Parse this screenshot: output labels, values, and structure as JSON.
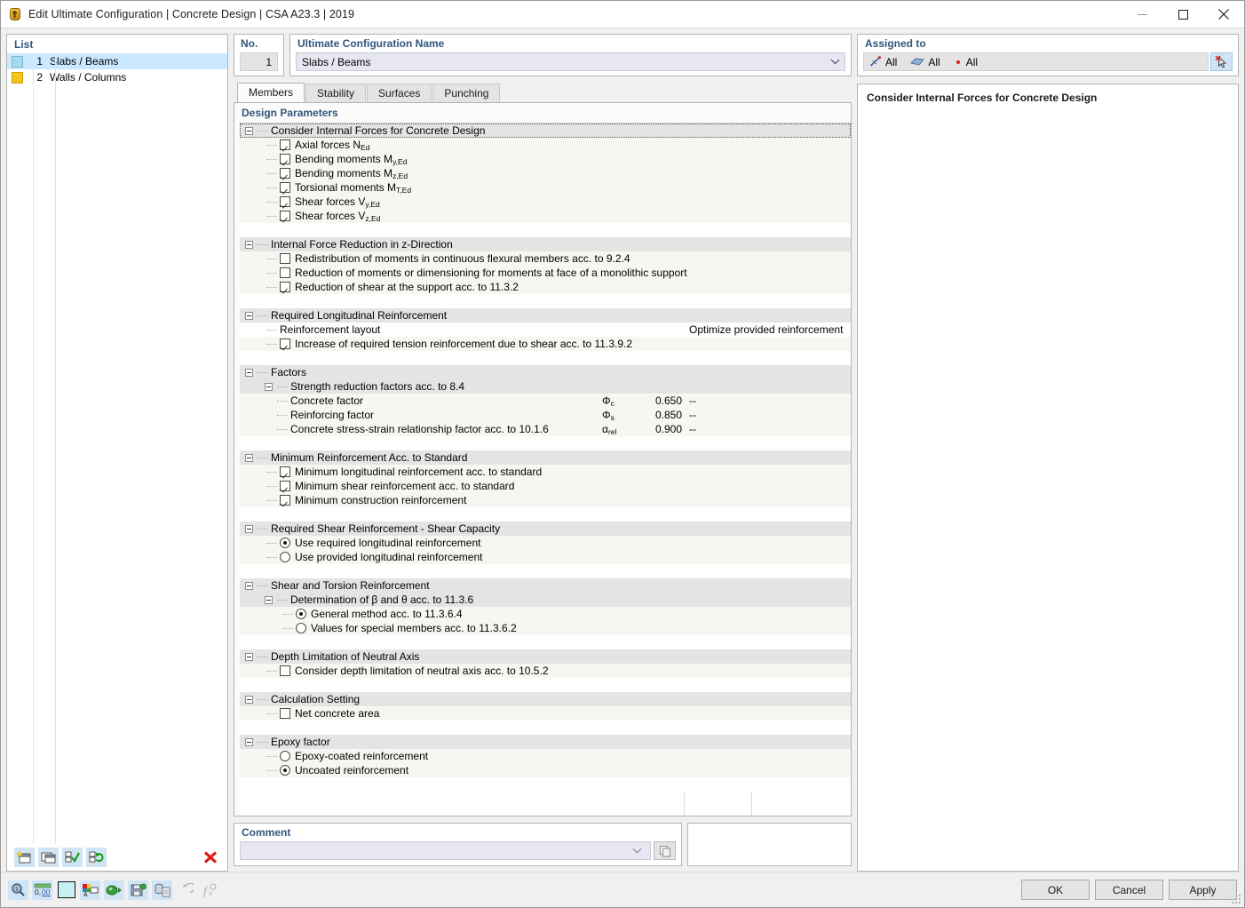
{
  "window": {
    "title": "Edit Ultimate Configuration | Concrete Design | CSA A23.3 | 2019",
    "app_icon": "configuration-icon",
    "minimize": "–",
    "maximize": "□",
    "close": "✕"
  },
  "list_panel": {
    "header": "List",
    "items": [
      {
        "num": "1",
        "label": "Slabs / Beams",
        "color": "#9fdcf0",
        "selected": true
      },
      {
        "num": "2",
        "label": "Walls / Columns",
        "color": "#f5c518",
        "selected": false
      }
    ],
    "toolbar": [
      {
        "name": "new-item-button",
        "glyph": "new"
      },
      {
        "name": "copy-item-button",
        "glyph": "copy"
      },
      {
        "name": "select-all-button",
        "glyph": "check-all"
      },
      {
        "name": "invert-selection-button",
        "glyph": "refresh-check"
      },
      {
        "name": "delete-item-button",
        "glyph": "red-x"
      }
    ]
  },
  "header_fields": {
    "no_label": "No.",
    "no_value": "1",
    "name_label": "Ultimate Configuration Name",
    "name_value": "Slabs / Beams"
  },
  "tabs": [
    {
      "label": "Members",
      "active": true
    },
    {
      "label": "Stability",
      "active": false
    },
    {
      "label": "Surfaces",
      "active": false
    },
    {
      "label": "Punching",
      "active": false
    }
  ],
  "params": {
    "title": "Design Parameters",
    "rows": [
      {
        "type": "group",
        "label": "Consider Internal Forces for Concrete Design",
        "expanded": true,
        "focused": true,
        "indent": 0
      },
      {
        "type": "check",
        "label": "Axial forces N",
        "sub": "Ed",
        "checked": true
      },
      {
        "type": "check",
        "label": "Bending moments M",
        "sub": "y,Ed",
        "checked": true
      },
      {
        "type": "check",
        "label": "Bending moments M",
        "sub": "z,Ed",
        "checked": true
      },
      {
        "type": "check",
        "label": "Torsional moments M",
        "sub": "T,Ed",
        "checked": true
      },
      {
        "type": "check",
        "label": "Shear forces V",
        "sub": "y,Ed",
        "checked": true
      },
      {
        "type": "check",
        "label": "Shear forces V",
        "sub": "z,Ed",
        "checked": true
      },
      {
        "type": "blank"
      },
      {
        "type": "group",
        "label": "Internal Force Reduction in z-Direction",
        "expanded": true,
        "indent": 0
      },
      {
        "type": "check",
        "label": "Redistribution of moments in continuous flexural members acc. to 9.2.4",
        "checked": false
      },
      {
        "type": "check",
        "label": "Reduction of moments or dimensioning for moments at face of a monolithic support",
        "checked": false
      },
      {
        "type": "check",
        "label": "Reduction of shear at the support acc. to 11.3.2",
        "checked": true
      },
      {
        "type": "blank"
      },
      {
        "type": "group",
        "label": "Required Longitudinal Reinforcement",
        "expanded": true,
        "indent": 0
      },
      {
        "type": "text",
        "label": "Reinforcement layout",
        "col1": "Optimize provided reinforcement"
      },
      {
        "type": "check",
        "label": "Increase of required tension reinforcement due to shear acc. to 11.3.9.2",
        "checked": true
      },
      {
        "type": "blank"
      },
      {
        "type": "group",
        "label": "Factors",
        "expanded": true,
        "indent": 0
      },
      {
        "type": "group",
        "label": "Strength reduction factors acc. to 8.4",
        "expanded": true,
        "indent": 1
      },
      {
        "type": "value",
        "label": "Concrete factor",
        "symbol": "Φ",
        "symsub": "c",
        "value": "0.650",
        "unit": "--"
      },
      {
        "type": "value",
        "label": "Reinforcing factor",
        "symbol": "Φ",
        "symsub": "s",
        "value": "0.850",
        "unit": "--"
      },
      {
        "type": "value",
        "label": "Concrete stress-strain relationship factor acc. to 10.1.6",
        "symbol": "α",
        "symsub": "rel",
        "value": "0.900",
        "unit": "--"
      },
      {
        "type": "blank"
      },
      {
        "type": "group",
        "label": "Minimum Reinforcement Acc. to Standard",
        "expanded": true,
        "indent": 0
      },
      {
        "type": "check",
        "label": "Minimum longitudinal reinforcement acc. to standard",
        "checked": true
      },
      {
        "type": "check",
        "label": "Minimum shear reinforcement acc. to standard",
        "checked": true
      },
      {
        "type": "check",
        "label": "Minimum construction reinforcement",
        "checked": true
      },
      {
        "type": "blank"
      },
      {
        "type": "group",
        "label": "Required Shear Reinforcement - Shear Capacity",
        "expanded": true,
        "indent": 0
      },
      {
        "type": "radio",
        "label": "Use required longitudinal reinforcement",
        "checked": true
      },
      {
        "type": "radio",
        "label": "Use provided longitudinal reinforcement",
        "checked": false
      },
      {
        "type": "blank"
      },
      {
        "type": "group",
        "label": "Shear and Torsion Reinforcement",
        "expanded": true,
        "indent": 0
      },
      {
        "type": "group",
        "label": "Determination of β and θ acc. to 11.3.6",
        "expanded": true,
        "indent": 1
      },
      {
        "type": "radio",
        "label": "General method acc. to 11.3.6.4",
        "checked": true,
        "deep": true
      },
      {
        "type": "radio",
        "label": "Values for special members acc. to 11.3.6.2",
        "checked": false,
        "deep": true
      },
      {
        "type": "blank"
      },
      {
        "type": "group",
        "label": "Depth Limitation of Neutral Axis",
        "expanded": true,
        "indent": 0
      },
      {
        "type": "check",
        "label": "Consider depth limitation of neutral axis acc. to 10.5.2",
        "checked": false
      },
      {
        "type": "blank"
      },
      {
        "type": "group",
        "label": "Calculation Setting",
        "expanded": true,
        "indent": 0
      },
      {
        "type": "check",
        "label": "Net concrete area",
        "checked": false
      },
      {
        "type": "blank"
      },
      {
        "type": "group",
        "label": "Epoxy factor",
        "expanded": true,
        "indent": 0
      },
      {
        "type": "radio",
        "label": "Epoxy-coated reinforcement",
        "checked": false
      },
      {
        "type": "radio",
        "label": "Uncoated reinforcement",
        "checked": true
      },
      {
        "type": "blank"
      }
    ]
  },
  "comment": {
    "label": "Comment",
    "value": "",
    "placeholder": ""
  },
  "assigned": {
    "label": "Assigned to",
    "items": [
      {
        "icon": "member-icon",
        "label": "All"
      },
      {
        "icon": "surface-icon",
        "label": "All"
      },
      {
        "icon": "node-icon",
        "label": "All"
      }
    ],
    "picker_button": "select-in-model-button"
  },
  "info": {
    "title": "Consider Internal Forces for Concrete Design"
  },
  "footer": {
    "tools": [
      {
        "name": "search-tool-button",
        "glyph": "magnifier"
      },
      {
        "name": "decimal-places-button",
        "glyph": "0,00"
      },
      {
        "name": "color-swatch-button",
        "glyph": "swatch"
      },
      {
        "name": "display-properties-button",
        "glyph": "properties"
      },
      {
        "name": "import-button",
        "glyph": "import"
      },
      {
        "name": "save-button",
        "glyph": "save"
      },
      {
        "name": "database-button",
        "glyph": "database"
      },
      {
        "name": "undo-button",
        "glyph": "undo",
        "disabled": true
      },
      {
        "name": "formula-button",
        "glyph": "formula",
        "disabled": true
      }
    ],
    "ok": "OK",
    "cancel": "Cancel",
    "apply": "Apply"
  },
  "colors": {
    "accent_label": "#31577d",
    "selection": "#cce8ff",
    "group_bg": "#e4e4e4",
    "row_bg": "#f7f7f2",
    "toolbtn_bg": "#cfe4f5"
  }
}
